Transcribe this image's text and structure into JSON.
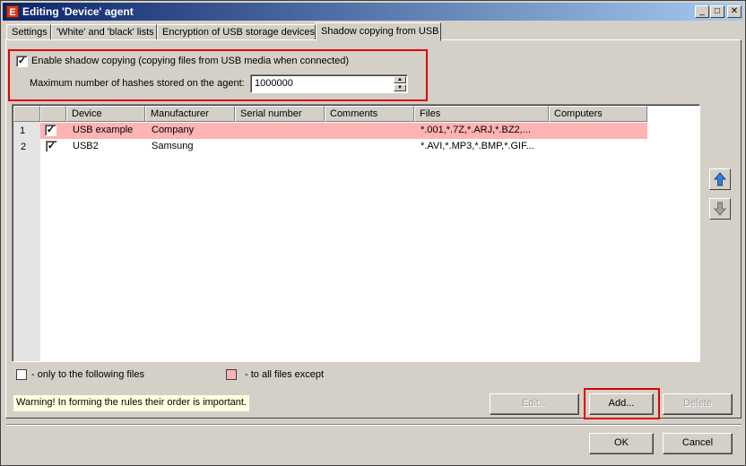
{
  "window": {
    "title": "Editing 'Device' agent",
    "icon_letter": "E",
    "minimize": "_",
    "maximize": "□",
    "close": "✕"
  },
  "tabs": [
    {
      "label": "Settings"
    },
    {
      "label": "'White' and 'black' lists"
    },
    {
      "label": "Encryption of USB storage devices"
    },
    {
      "label": "Shadow copying from USB"
    }
  ],
  "shadow": {
    "enable_checked": true,
    "enable_label": "Enable shadow copying (copying files from USB media when connected)",
    "max_hashes_label": "Maximum number of hashes stored on the agent:",
    "max_hashes_value": "1000000"
  },
  "grid": {
    "columns": [
      "Device",
      "Manufacturer",
      "Serial number",
      "Comments",
      "Files",
      "Computers"
    ],
    "rows": [
      {
        "num": "1",
        "checked": true,
        "device": "USB example",
        "manufacturer": "Company",
        "serial": "",
        "comments": "",
        "files": "*.001,*.7Z,*.ARJ,*.BZ2,...",
        "computers": "",
        "highlight": "#ffb3b3"
      },
      {
        "num": "2",
        "checked": true,
        "device": "USB2",
        "manufacturer": "Samsung",
        "serial": "",
        "comments": "",
        "files": "*.AVI,*.MP3,*.BMP,*.GIF...",
        "computers": "",
        "highlight": ""
      }
    ]
  },
  "legend": {
    "only_label": "- only to the following files",
    "except_label": "- to all files except",
    "except_color": "#ffb3b3"
  },
  "warning": "Warning! In forming the rules their order is important.",
  "buttons": {
    "edit": "Edit...",
    "add": "Add...",
    "delete": "Delete",
    "ok": "OK",
    "cancel": "Cancel",
    "move_up_icon": "arrow-up-icon",
    "move_down_icon": "arrow-down-icon"
  }
}
